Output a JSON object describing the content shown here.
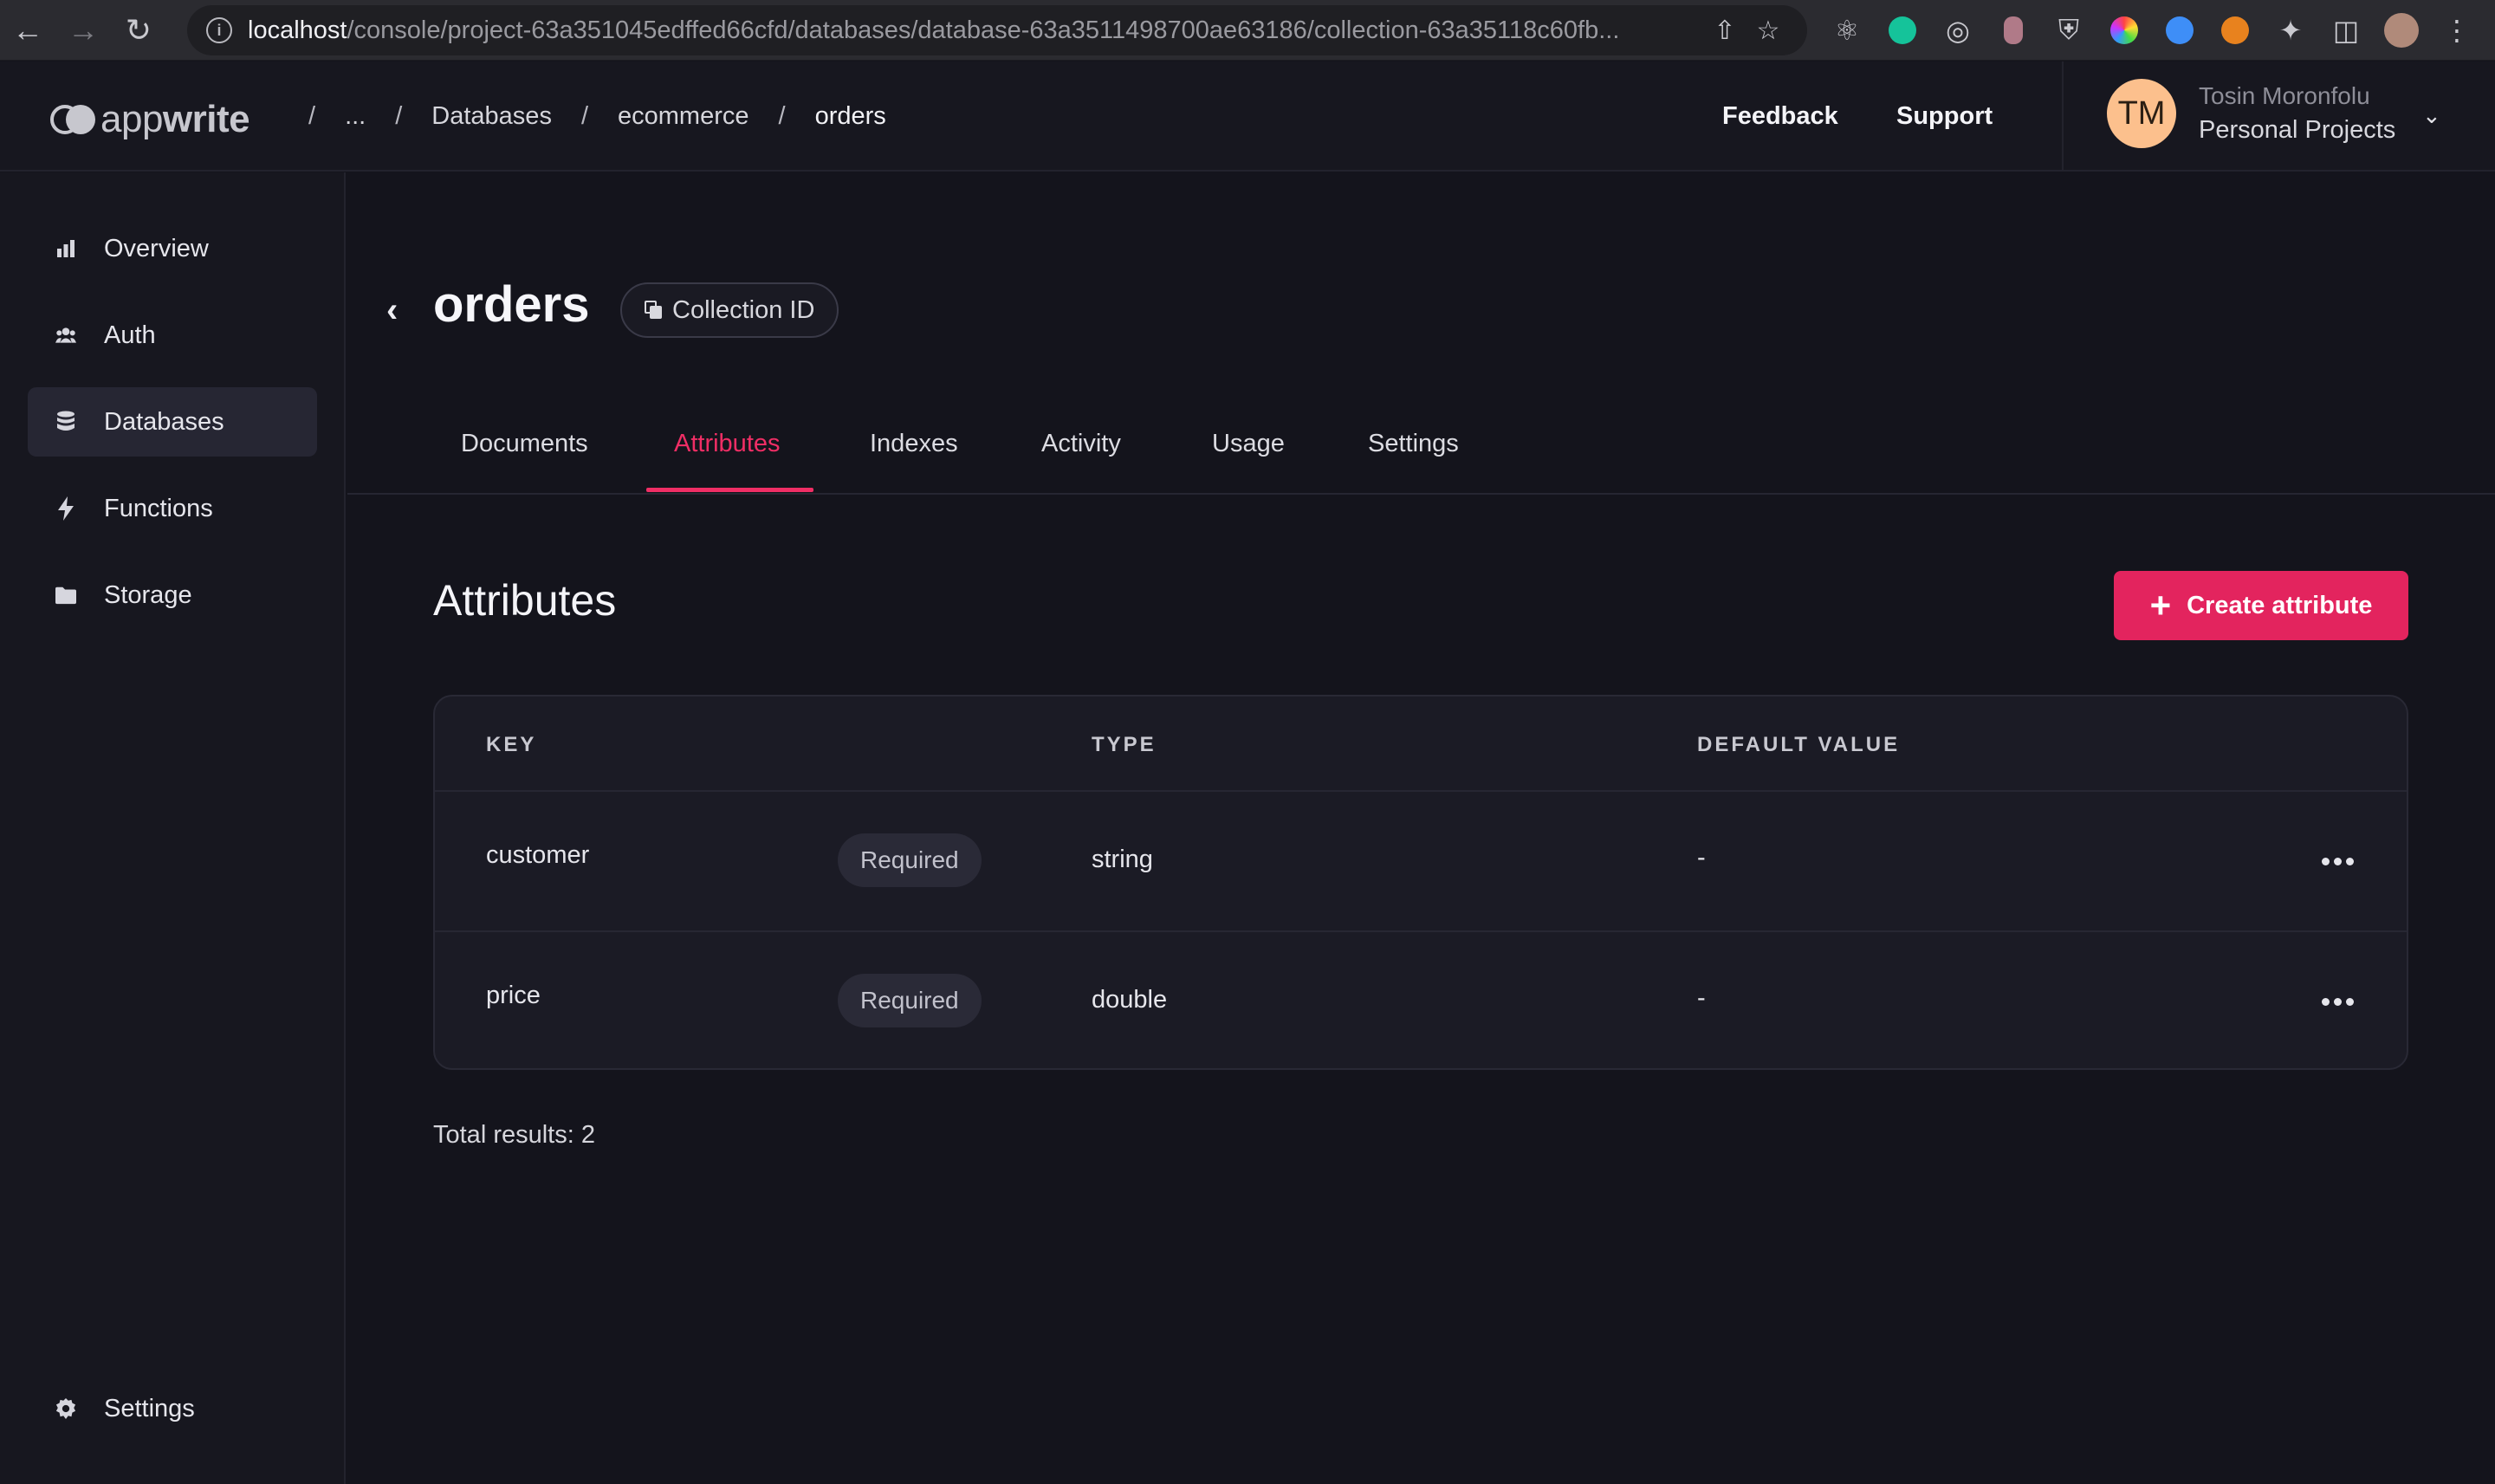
{
  "browser": {
    "url_host": "localhost",
    "url_path": "/console/project-63a351045edffed66cfd/databases/database-63a3511498700ae63186/collection-63a35118c60fb..."
  },
  "app": {
    "logo_light": "app",
    "logo_bold": "write"
  },
  "breadcrumb": {
    "sep": "/",
    "items": [
      "...",
      "Databases",
      "ecommerce",
      "orders"
    ]
  },
  "header": {
    "feedback": "Feedback",
    "support": "Support",
    "user_initials": "TM",
    "user_name": "Tosin Moronfolu",
    "user_org": "Personal Projects"
  },
  "sidebar": {
    "items": [
      {
        "label": "Overview",
        "icon": "chart-bar-icon"
      },
      {
        "label": "Auth",
        "icon": "users-icon"
      },
      {
        "label": "Databases",
        "icon": "database-icon"
      },
      {
        "label": "Functions",
        "icon": "lightning-icon"
      },
      {
        "label": "Storage",
        "icon": "folder-icon"
      }
    ],
    "settings": "Settings"
  },
  "page": {
    "title": "orders",
    "collection_id_label": "Collection ID"
  },
  "tabs": [
    "Documents",
    "Attributes",
    "Indexes",
    "Activity",
    "Usage",
    "Settings"
  ],
  "active_tab": "Attributes",
  "section": {
    "title": "Attributes",
    "create_button": "Create attribute"
  },
  "table": {
    "columns": [
      "KEY",
      "TYPE",
      "DEFAULT VALUE"
    ],
    "rows": [
      {
        "key": "customer",
        "required": "Required",
        "type": "string",
        "default": "-"
      },
      {
        "key": "price",
        "required": "Required",
        "type": "double",
        "default": "-"
      }
    ]
  },
  "total_results": "Total results: 2",
  "colors": {
    "accent": "#f02e65",
    "button": "#e3245e",
    "avatar": "#fcc08d",
    "background": "#14141c"
  }
}
